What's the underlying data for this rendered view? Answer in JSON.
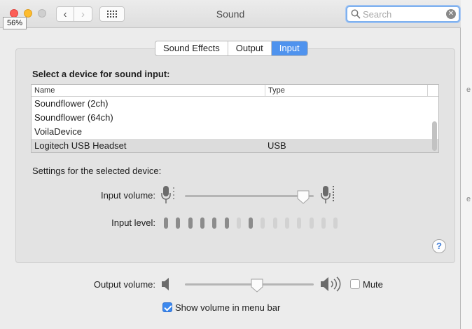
{
  "window": {
    "title": "Sound"
  },
  "search": {
    "placeholder": "Search",
    "value": ""
  },
  "zoom_badge": "56%",
  "tabs": [
    {
      "label": "Sound Effects",
      "active": false
    },
    {
      "label": "Output",
      "active": false
    },
    {
      "label": "Input",
      "active": true
    }
  ],
  "input": {
    "section_title": "Select a device for sound input:",
    "columns": {
      "name": "Name",
      "type": "Type"
    },
    "devices": [
      {
        "name": "Soundflower (2ch)",
        "type": ""
      },
      {
        "name": "Soundflower (64ch)",
        "type": ""
      },
      {
        "name": "VoilaDevice",
        "type": ""
      },
      {
        "name": "Logitech USB Headset",
        "type": "USB",
        "selected": true
      }
    ],
    "settings_label": "Settings for the selected device:",
    "volume_label": "Input volume:",
    "volume_value": 0.92,
    "level_label": "Input level:",
    "level_active_segments": [
      true,
      true,
      true,
      true,
      true,
      true,
      false,
      true,
      false,
      false,
      false,
      false,
      false,
      false,
      false
    ],
    "help_label": "?"
  },
  "output": {
    "volume_label": "Output volume:",
    "volume_value": 0.56,
    "mute_label": "Mute",
    "mute_checked": false,
    "menu_bar_label": "Show volume in menu bar",
    "menu_bar_checked": true
  },
  "colors": {
    "accent": "#4f93ee",
    "level_on": "#8c8c8c",
    "level_off": "#d2d2d2"
  }
}
